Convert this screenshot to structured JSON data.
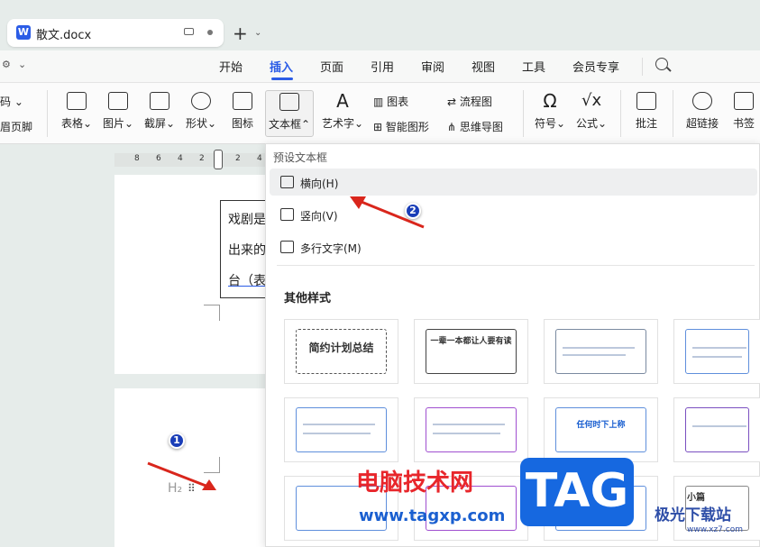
{
  "tab": {
    "title": "散文.docx",
    "logo": "W"
  },
  "menu": {
    "items": [
      "开始",
      "插入",
      "页面",
      "引用",
      "审阅",
      "视图",
      "工具",
      "会员专享"
    ],
    "active": "插入"
  },
  "ribbon": {
    "left_partial": [
      "码",
      "眉页脚"
    ],
    "buttons": [
      "表格",
      "图片",
      "截屏",
      "形状",
      "图标",
      "文本框",
      "艺术字"
    ],
    "small_buttons": [
      "图表",
      "智能图形",
      "流程图",
      "思维导图"
    ],
    "right_buttons": [
      "符号",
      "公式",
      "批注",
      "超链接",
      "书签"
    ]
  },
  "ruler": {
    "ticks": [
      "8",
      "6",
      "4",
      "2",
      "2",
      "4"
    ]
  },
  "document": {
    "text_lines": [
      "戏剧是",
      "出来的",
      "台（表"
    ],
    "heading_mark": "H₂"
  },
  "dropdown": {
    "header": "预设文本框",
    "items": [
      {
        "label": "横向(H)",
        "icon": "horizontal-textbox-icon"
      },
      {
        "label": "竖向(V)",
        "icon": "vertical-textbox-icon"
      },
      {
        "label": "多行文字(M)",
        "icon": "multiline-textbox-icon"
      }
    ],
    "other_styles": "其他样式",
    "thumbnails": [
      {
        "text": "简约计划总结"
      },
      {
        "text": "一辈一本都让人要有读"
      },
      {
        "text": ""
      },
      {
        "text": ""
      },
      {
        "text": ""
      },
      {
        "text": ""
      },
      {
        "text": "任何时下上称"
      },
      {
        "text": ""
      },
      {
        "text": ""
      },
      {
        "text": ""
      },
      {
        "text": ""
      },
      {
        "text": "小篇"
      }
    ]
  },
  "annotations": {
    "badge1": "1",
    "badge2": "2"
  },
  "watermarks": {
    "cn": "电脑技术网",
    "url": "www.tagxp.com",
    "tag": "TAG",
    "site2": "极光下载站",
    "site2_url": "www.xz7.com"
  }
}
